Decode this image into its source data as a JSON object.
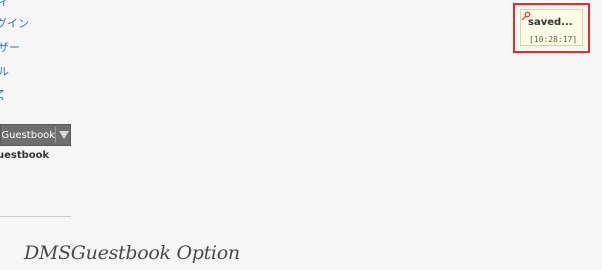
{
  "sidebar": {
    "items": [
      {
        "label": "ィ"
      },
      {
        "label": "グイン"
      },
      {
        "label": "ザー"
      },
      {
        "label": "ル"
      },
      {
        "label": "ζ"
      }
    ]
  },
  "widget": {
    "button_label": "SGuestbook",
    "caption": "uestbook",
    "arrow_icon": "chevron-down-icon"
  },
  "main": {
    "title": "DMSGuestbook Option"
  },
  "notification": {
    "title": "saved...",
    "time": "[10:28:17]",
    "icon": "pin-icon",
    "highlight_color": "#d9302b"
  }
}
